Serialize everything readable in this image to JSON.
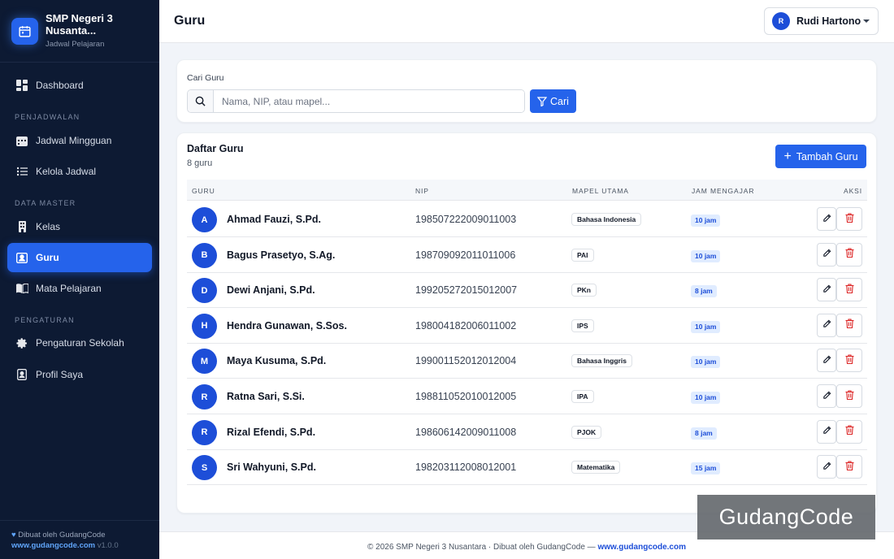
{
  "brand": {
    "name": "SMP Negeri 3 Nusanta...",
    "subtitle": "Jadwal Pelajaran"
  },
  "nav": {
    "dashboard": "Dashboard",
    "section_penjadwalan": "PENJADWALAN",
    "jadwal_mingguan": "Jadwal Mingguan",
    "kelola_jadwal": "Kelola Jadwal",
    "section_data_master": "DATA MASTER",
    "kelas": "Kelas",
    "guru": "Guru",
    "mata_pelajaran": "Mata Pelajaran",
    "section_pengaturan": "PENGATURAN",
    "pengaturan_sekolah": "Pengaturan Sekolah",
    "profil_saya": "Profil Saya"
  },
  "sidebar_footer": {
    "line1": "Dibuat oleh GudangCode",
    "link": "www.gudangcode.com",
    "version": "v1.0.0"
  },
  "header": {
    "title": "Guru",
    "user_initial": "R",
    "user_name": "Rudi Hartono"
  },
  "search": {
    "label": "Cari Guru",
    "placeholder": "Nama, NIP, atau mapel...",
    "value": "",
    "button": "Cari"
  },
  "list": {
    "title": "Daftar Guru",
    "count": "8 guru",
    "add_button": "Tambah Guru",
    "columns": [
      "GURU",
      "NIP",
      "MAPEL UTAMA",
      "JAM MENGAJAR",
      "AKSI"
    ],
    "rows": [
      {
        "initial": "A",
        "name": "Ahmad Fauzi, S.Pd.",
        "nip": "198507222009011003",
        "mapel": "Bahasa Indonesia",
        "jam": "10 jam"
      },
      {
        "initial": "B",
        "name": "Bagus Prasetyo, S.Ag.",
        "nip": "198709092011011006",
        "mapel": "PAI",
        "jam": "10 jam"
      },
      {
        "initial": "D",
        "name": "Dewi Anjani, S.Pd.",
        "nip": "199205272015012007",
        "mapel": "PKn",
        "jam": "8 jam"
      },
      {
        "initial": "H",
        "name": "Hendra Gunawan, S.Sos.",
        "nip": "198004182006011002",
        "mapel": "IPS",
        "jam": "10 jam"
      },
      {
        "initial": "M",
        "name": "Maya Kusuma, S.Pd.",
        "nip": "199001152012012004",
        "mapel": "Bahasa Inggris",
        "jam": "10 jam"
      },
      {
        "initial": "R",
        "name": "Ratna Sari, S.Si.",
        "nip": "198811052010012005",
        "mapel": "IPA",
        "jam": "10 jam"
      },
      {
        "initial": "R",
        "name": "Rizal Efendi, S.Pd.",
        "nip": "198606142009011008",
        "mapel": "PJOK",
        "jam": "8 jam"
      },
      {
        "initial": "S",
        "name": "Sri Wahyuni, S.Pd.",
        "nip": "198203112008012001",
        "mapel": "Matematika",
        "jam": "15 jam"
      }
    ]
  },
  "footer": {
    "text": "© 2026 SMP Negeri 3 Nusantara · Dibuat oleh GudangCode — ",
    "link": "www.gudangcode.com"
  },
  "watermark": "GudangCode",
  "colors": {
    "accent": "#2563eb",
    "sidebar_bg": "#0d1a33",
    "danger": "#dc2626",
    "badge_bg": "#e0ecff"
  }
}
